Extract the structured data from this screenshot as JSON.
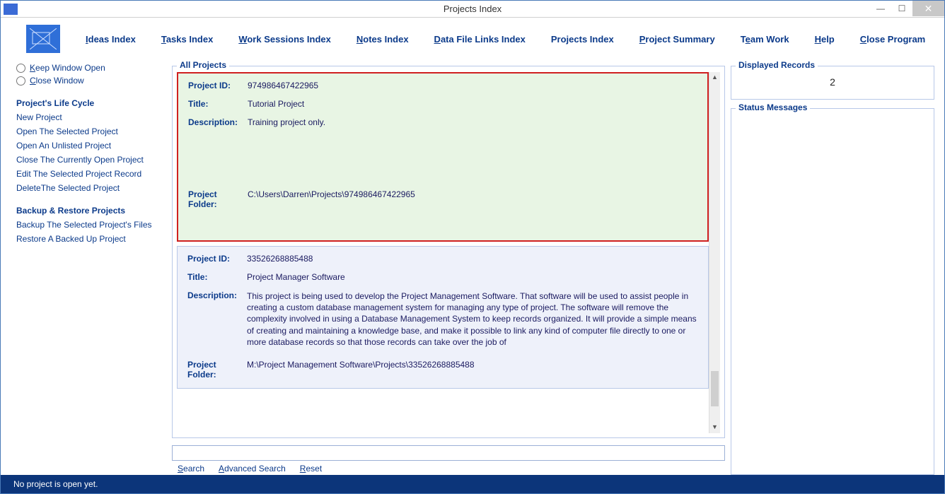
{
  "window": {
    "title": "Projects Index"
  },
  "menu": {
    "ideas": "Ideas Index",
    "tasks": "Tasks Index",
    "work": "Work Sessions Index",
    "notes": "Notes Index",
    "datafile": "Data File Links Index",
    "projects": "Projects Index",
    "summary": "Project Summary",
    "team": "Team Work",
    "help": "Help",
    "close": "Close Program"
  },
  "sidebar": {
    "keep_open": "eep Window Open",
    "close_window": "lose Window",
    "life_cycle_heading": "Project's Life Cycle",
    "life_cycle": [
      "New Project",
      "Open The Selected Project",
      "Open An Unlisted Project",
      "Close The Currently Open Project",
      "Edit The Selected Project Record",
      "DeleteThe Selected Project"
    ],
    "backup_heading": "Backup & Restore Projects",
    "backup": [
      "Backup The Selected Project's Files",
      "Restore A Backed Up Project"
    ]
  },
  "labels": {
    "all_projects": "All Projects",
    "project_id": "Project ID:",
    "title": "Title:",
    "description": "Description:",
    "project_folder": "Project Folder:",
    "displayed_records": "Displayed Records",
    "status_messages": "Status Messages",
    "search": "earch",
    "advanced_search": "dvanced Search",
    "reset": "eset"
  },
  "projects": [
    {
      "id": "974986467422965",
      "title": "Tutorial Project",
      "description": "Training project only.",
      "folder": "C:\\Users\\Darren\\Projects\\974986467422965",
      "selected": true
    },
    {
      "id": "33526268885488",
      "title": "Project Manager Software",
      "description": "This project is being used to develop the Project Management Software. That software will be used to assist people in creating a custom database management system for managing any type of project. The software will remove the complexity involved in using a Database Management System to keep records organized. It will provide a simple means of creating and maintaining a knowledge base, and make it possible to link any kind of computer file directly to one or more database records so that those records can take over the job of",
      "folder": "M:\\Project Management Software\\Projects\\33526268885488",
      "selected": false
    }
  ],
  "displayed_records": "2",
  "statusbar": "No project is open yet."
}
